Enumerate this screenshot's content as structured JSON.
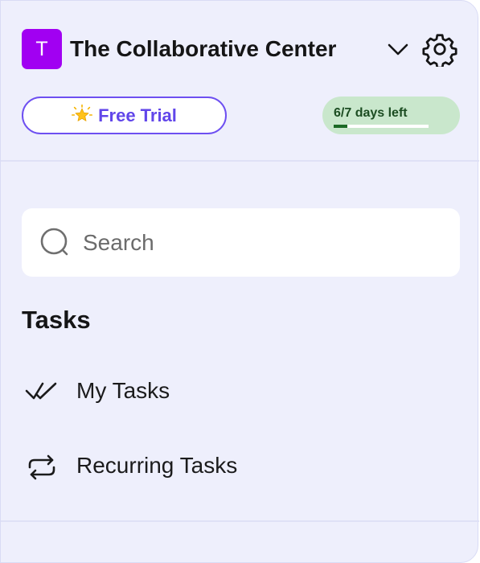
{
  "header": {
    "workspace_initial": "T",
    "workspace_name": "The Collaborative Center",
    "icons": {
      "dropdown": "chevron-down-icon",
      "settings": "gear-icon"
    },
    "avatar_color": "#a100f2"
  },
  "trial": {
    "button_label": "Free Trial",
    "icon": "star-icon",
    "days_left_label": "6/7 days left",
    "progress_fraction": 0.14
  },
  "search": {
    "placeholder": "Search",
    "value": "",
    "icon": "search-icon"
  },
  "tasks": {
    "section_title": "Tasks",
    "items": [
      {
        "label": "My Tasks",
        "icon": "double-check-icon"
      },
      {
        "label": "Recurring Tasks",
        "icon": "repeat-icon"
      }
    ]
  },
  "colors": {
    "accent": "#6146ea",
    "panel_background": "#eeeffc",
    "days_pill_background": "#c9e7cc",
    "days_progress": "#1c6a25"
  }
}
